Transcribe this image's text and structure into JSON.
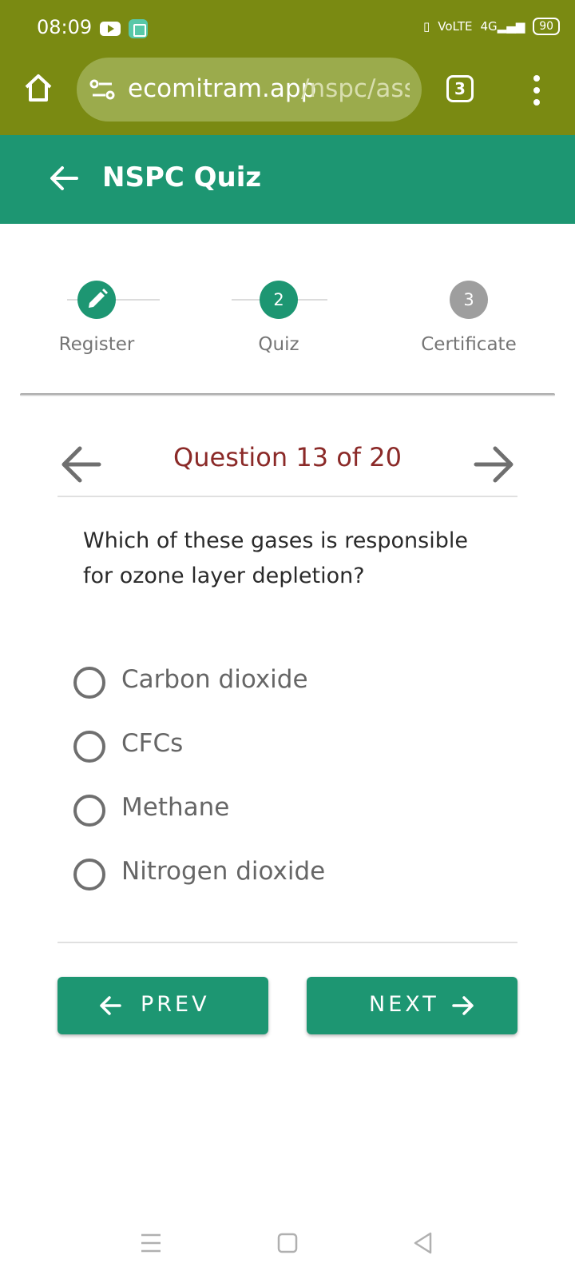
{
  "status_bar": {
    "time": "08:09",
    "icons": [
      "youtube-icon",
      "app-icon",
      "vibrate-icon",
      "volte-icon",
      "signal-4g-icon"
    ],
    "network": "4G",
    "battery": "90"
  },
  "browser": {
    "url_host": "ecomitram.app",
    "url_path": "/nspc/ass",
    "tab_count": "3",
    "icons": [
      "home-icon",
      "site-settings-icon",
      "tabs-icon",
      "menu-icon"
    ]
  },
  "appbar": {
    "title": "NSPC Quiz",
    "back_icon": "back-arrow-icon"
  },
  "stepper": {
    "steps": [
      {
        "label": "Register",
        "marker": "",
        "state": "done"
      },
      {
        "label": "Quiz",
        "marker": "2",
        "state": "active"
      },
      {
        "label": "Certificate",
        "marker": "3",
        "state": "pending"
      }
    ]
  },
  "quiz": {
    "counter": "Question 13 of 20",
    "question": "Which of these gases is responsible for ozone layer depletion?",
    "options": [
      "Carbon dioxide",
      "CFCs",
      "Methane",
      "Nitrogen dioxide"
    ],
    "prev_label": "PREV",
    "next_label": "NEXT"
  },
  "colors": {
    "browser_bar": "#7a8a12",
    "primary": "#1d9672",
    "question_title": "#8b2a28",
    "step_pending": "#9e9e9e"
  }
}
